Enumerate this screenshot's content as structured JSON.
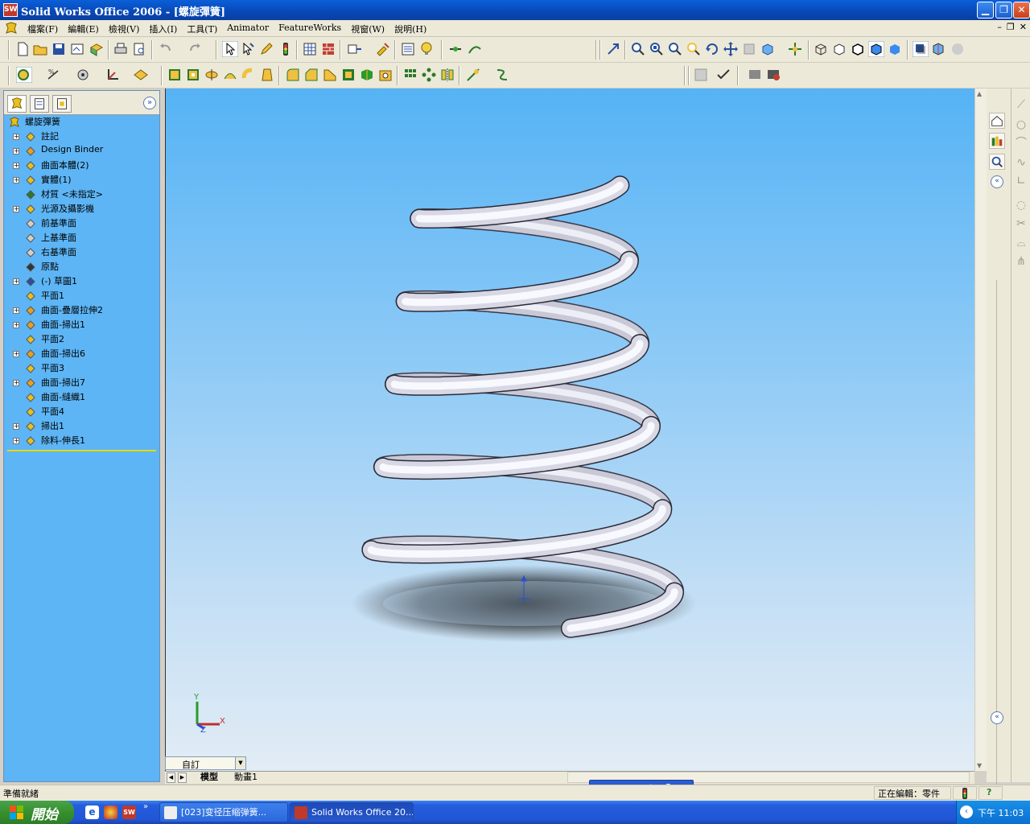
{
  "window": {
    "title": "Solid Works Office 2006 - [螺旋彈簧]",
    "app_icon": "SW"
  },
  "menu": {
    "items": [
      "檔案(F)",
      "編輯(E)",
      "檢視(V)",
      "插入(I)",
      "工具(T)",
      "Animator",
      "FeatureWorks",
      "視窗(W)",
      "說明(H)"
    ]
  },
  "tree": {
    "root": "螺旋彈簧",
    "items": [
      {
        "label": "註記",
        "expand": "+"
      },
      {
        "label": "Design Binder",
        "expand": "+"
      },
      {
        "label": "曲面本體(2)",
        "expand": "+"
      },
      {
        "label": "實體(1)",
        "expand": "+"
      },
      {
        "label": "材質 <未指定>",
        "expand": ""
      },
      {
        "label": "光源及攝影機",
        "expand": "+"
      },
      {
        "label": "前基準面",
        "expand": ""
      },
      {
        "label": "上基準面",
        "expand": ""
      },
      {
        "label": "右基準面",
        "expand": ""
      },
      {
        "label": "原點",
        "expand": ""
      },
      {
        "label": "(-) 草圖1",
        "expand": "+"
      },
      {
        "label": "平面1",
        "expand": ""
      },
      {
        "label": "曲面-疊層拉伸2",
        "expand": "+"
      },
      {
        "label": "曲面-掃出1",
        "expand": "+"
      },
      {
        "label": "平面2",
        "expand": ""
      },
      {
        "label": "曲面-掃出6",
        "expand": "+"
      },
      {
        "label": "平面3",
        "expand": ""
      },
      {
        "label": "曲面-掃出7",
        "expand": "+"
      },
      {
        "label": "曲面-縫織1",
        "expand": ""
      },
      {
        "label": "平面4",
        "expand": ""
      },
      {
        "label": "掃出1",
        "expand": "+"
      },
      {
        "label": "除料-伸長1",
        "expand": "+"
      }
    ]
  },
  "viewport": {
    "triad": {
      "x": "X",
      "y": "Y",
      "z": "Z"
    },
    "view_orientation": "自訂"
  },
  "doc_tabs": [
    "模型",
    "動畫1"
  ],
  "status": {
    "left": "準備就緒",
    "editing": "正在編輯：零件",
    "help_icon": "?"
  },
  "ime": {
    "items": [
      "䆯",
      "䆯",
      "▯",
      "✎",
      "?"
    ]
  },
  "taskbar": {
    "start": "開始",
    "tasks": [
      "[023]变径压缩弹簧...",
      "Solid Works Office 20..."
    ],
    "clock": "下午 11:03"
  },
  "colors": {
    "title_blue": "#0a5fd8",
    "viewport_top": "#55b3f5",
    "viewport_bottom": "#e2ecf5",
    "tree_bg": "#5db5f5",
    "spring": "#e8e8f0"
  }
}
